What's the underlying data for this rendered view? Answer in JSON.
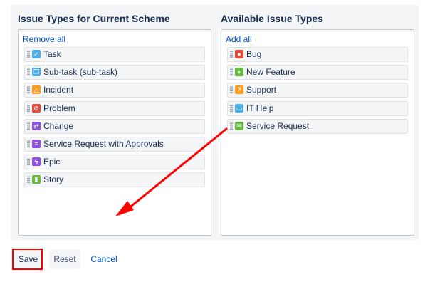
{
  "left_panel": {
    "title": "Issue Types for Current Scheme",
    "action": "Remove all",
    "items": [
      {
        "label": "Task",
        "icon": "task-icon",
        "color": "#4bade8",
        "glyph": "✓"
      },
      {
        "label": "Sub-task (sub-task)",
        "icon": "subtask-icon",
        "color": "#4bade8",
        "glyph": "❐"
      },
      {
        "label": "Incident",
        "icon": "incident-icon",
        "color": "#ff991f",
        "glyph": "△"
      },
      {
        "label": "Problem",
        "icon": "problem-icon",
        "color": "#e5493a",
        "glyph": "⊘"
      },
      {
        "label": "Change",
        "icon": "change-icon",
        "color": "#904ee2",
        "glyph": "⇄"
      },
      {
        "label": "Service Request with Approvals",
        "icon": "service-request-approvals-icon",
        "color": "#904ee2",
        "glyph": "≡"
      },
      {
        "label": "Epic",
        "icon": "epic-icon",
        "color": "#904ee2",
        "glyph": "ϟ"
      },
      {
        "label": "Story",
        "icon": "story-icon",
        "color": "#63ba3c",
        "glyph": "▮"
      }
    ]
  },
  "right_panel": {
    "title": "Available Issue Types",
    "action": "Add all",
    "items": [
      {
        "label": "Bug",
        "icon": "bug-icon",
        "color": "#e5493a",
        "glyph": "●"
      },
      {
        "label": "New Feature",
        "icon": "new-feature-icon",
        "color": "#63ba3c",
        "glyph": "+"
      },
      {
        "label": "Support",
        "icon": "support-icon",
        "color": "#ff991f",
        "glyph": "?"
      },
      {
        "label": "IT Help",
        "icon": "it-help-icon",
        "color": "#4bade8",
        "glyph": "▭"
      },
      {
        "label": "Service Request",
        "icon": "service-request-icon",
        "color": "#63ba3c",
        "glyph": "✉"
      }
    ]
  },
  "buttons": {
    "save": "Save",
    "reset": "Reset",
    "cancel": "Cancel"
  },
  "annotation": {
    "arrow_color": "#ff0000",
    "highlight_color": "#ff0000"
  }
}
